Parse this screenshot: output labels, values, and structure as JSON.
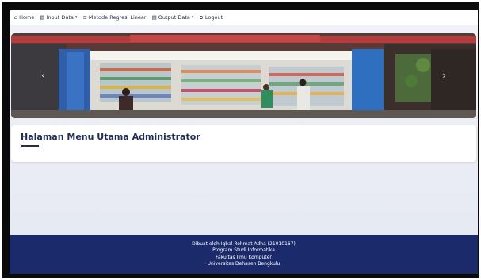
{
  "navbar": {
    "items": [
      {
        "label": "Home",
        "icon": "home-icon"
      },
      {
        "label": "Input Data",
        "icon": "database-icon",
        "dropdown": true
      },
      {
        "label": "Metode Regresi Linear",
        "icon": "chart-icon"
      },
      {
        "label": "Output Data",
        "icon": "database-icon",
        "dropdown": true
      },
      {
        "label": "Logout",
        "icon": "logout-icon"
      }
    ]
  },
  "main": {
    "page_title": "Halaman Menu Utama Administrator"
  },
  "footer": {
    "lines": [
      "Dibuat oleh Iqbal Rohmat Adha (21010167)",
      "Program Studi Informatika",
      "Fakultas Ilmu Komputer",
      "Universitas Dehasen Bengkulu"
    ]
  },
  "colors": {
    "navy": "#1f2d5a",
    "footer_bg": "#1a2a6b"
  }
}
